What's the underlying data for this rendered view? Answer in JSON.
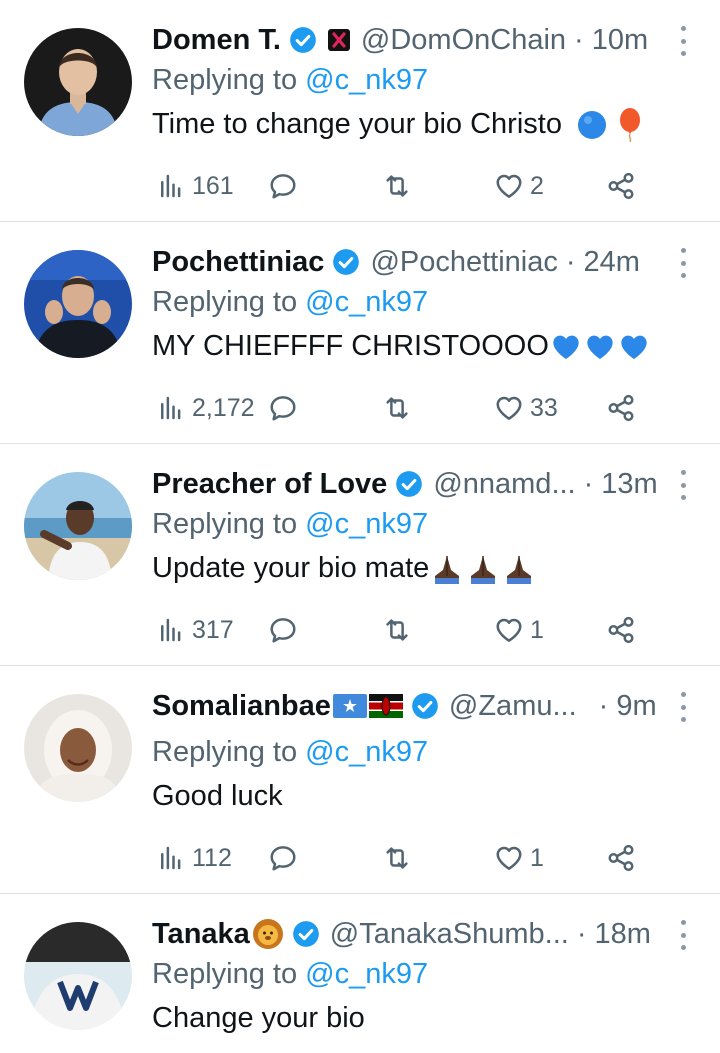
{
  "replying_prefix": "Replying to ",
  "accent_color": "#1d9bf0",
  "muted_color": "#536471",
  "tweets": [
    {
      "name": "Domen T.",
      "verified": true,
      "badge": "x-badge-icon",
      "handle": "@DomOnChain",
      "time": "10m",
      "mention": "@c_nk97",
      "text": "Time to change your bio Christo",
      "text_emoji": [
        "blue-circle-icon",
        "balloon-icon"
      ],
      "views": "161",
      "replies": "",
      "retweets": "",
      "likes": "2"
    },
    {
      "name": "Pochettiniac",
      "verified": true,
      "handle": "@Pochettiniac",
      "time": "24m",
      "mention": "@c_nk97",
      "text": "MY CHIEFFFF CHRISTOOOO",
      "text_emoji": [
        "blue-heart-icon",
        "blue-heart-icon",
        "blue-heart-icon"
      ],
      "views": "2,172",
      "replies": "",
      "retweets": "",
      "likes": "33"
    },
    {
      "name": "Preacher of Love",
      "verified": true,
      "handle": "@nnamd...",
      "time": "13m",
      "mention": "@c_nk97",
      "text": "Update your bio mate",
      "text_emoji": [
        "praying-hands-icon",
        "praying-hands-icon",
        "praying-hands-icon"
      ],
      "views": "317",
      "replies": "",
      "retweets": "",
      "likes": "1"
    },
    {
      "name": "Somalianbae",
      "name_emoji": [
        "somalia-flag-icon",
        "kenya-flag-icon"
      ],
      "verified": true,
      "handle": "@Zamu...",
      "time": "9m",
      "mention": "@c_nk97",
      "text": "Good luck",
      "views": "112",
      "replies": "",
      "retweets": "",
      "likes": "1"
    },
    {
      "name": "Tanaka",
      "name_emoji": [
        "lion-face-icon"
      ],
      "verified": true,
      "handle": "@TanakaShumb...",
      "time": "18m",
      "mention": "@c_nk97",
      "text": "Change your bio"
    }
  ]
}
